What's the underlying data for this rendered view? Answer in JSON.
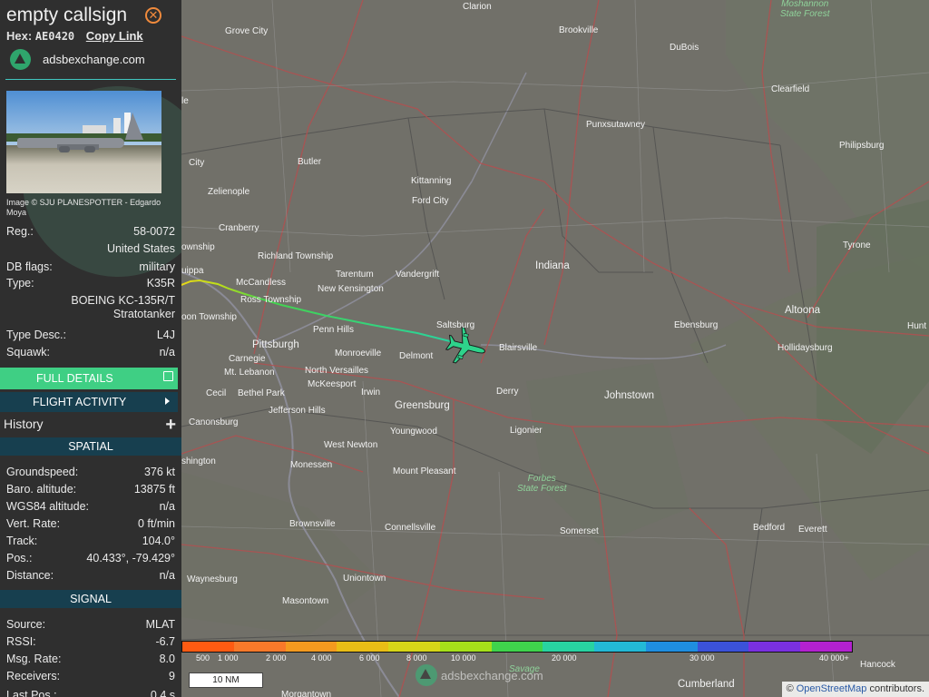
{
  "header": {
    "callsign": "empty callsign",
    "hex_label": "Hex:",
    "hex_value": "AE0420",
    "copy_link": "Copy Link",
    "site": "adsbexchange.com"
  },
  "photo": {
    "credit": "Image © SJU PLANESPOTTER - Edgardo Moya"
  },
  "aircraft": {
    "reg_label": "Reg.:",
    "reg": "58-0072",
    "country": "United States",
    "dbflags_label": "DB flags:",
    "dbflags": "military",
    "type_label": "Type:",
    "type": "K35R",
    "model": "BOEING KC-135R/T",
    "model2": "Stratotanker",
    "typedesc_label": "Type Desc.:",
    "typedesc": "L4J",
    "squawk_label": "Squawk:",
    "squawk": "n/a"
  },
  "buttons": {
    "full_details": "FULL DETAILS",
    "flight_activity": "FLIGHT ACTIVITY",
    "history": "History",
    "history_plus": "+"
  },
  "spatial": {
    "title": "SPATIAL",
    "rows": [
      {
        "label": "Groundspeed:",
        "value": "376 kt"
      },
      {
        "label": "Baro. altitude:",
        "value": "13875 ft"
      },
      {
        "label": "WGS84 altitude:",
        "value": "n/a"
      },
      {
        "label": "Vert. Rate:",
        "value": "0 ft/min"
      },
      {
        "label": "Track:",
        "value": "104.0°"
      },
      {
        "label": "Pos.:",
        "value": "40.433°, -79.429°"
      },
      {
        "label": "Distance:",
        "value": "n/a"
      }
    ]
  },
  "signal": {
    "title": "SIGNAL",
    "rows": [
      {
        "label": "Source:",
        "value": "MLAT"
      },
      {
        "label": "RSSI:",
        "value": "-6.7"
      },
      {
        "label": "Msg. Rate:",
        "value": "8.0"
      },
      {
        "label": "Receivers:",
        "value": "9"
      },
      {
        "label": "Last Pos.:",
        "value": "0.4 s"
      }
    ]
  },
  "map": {
    "towns": [
      {
        "name": "Clarion"
      },
      {
        "name": "Grove City"
      },
      {
        "name": "Brookville"
      },
      {
        "name": "DuBois"
      },
      {
        "name": "Clearfield"
      },
      {
        "name": "Punxsutawney"
      },
      {
        "name": "Philipsburg"
      },
      {
        "name": "Butler"
      },
      {
        "name": "Kittanning"
      },
      {
        "name": "Ford City"
      },
      {
        "name": "Zelienople"
      },
      {
        "name": "Cranberry"
      },
      {
        "name": "Richland Township"
      },
      {
        "name": "McCandless"
      },
      {
        "name": "Tarentum"
      },
      {
        "name": "Vandergrift"
      },
      {
        "name": "New Kensington"
      },
      {
        "name": "Indiana"
      },
      {
        "name": "Tyrone"
      },
      {
        "name": "Ross Township"
      },
      {
        "name": "Saltsburg"
      },
      {
        "name": "Ebensburg"
      },
      {
        "name": "Altoona"
      },
      {
        "name": "Penn Hills"
      },
      {
        "name": "Pittsburgh"
      },
      {
        "name": "Blairsville"
      },
      {
        "name": "Hollidaysburg"
      },
      {
        "name": "Monroeville"
      },
      {
        "name": "Delmont"
      },
      {
        "name": "Carnegie"
      },
      {
        "name": "Mt. Lebanon"
      },
      {
        "name": "North Versailles"
      },
      {
        "name": "McKeesport"
      },
      {
        "name": "Derry"
      },
      {
        "name": "Johnstown"
      },
      {
        "name": "Cecil"
      },
      {
        "name": "Bethel Park"
      },
      {
        "name": "Irwin"
      },
      {
        "name": "Greensburg"
      },
      {
        "name": "Jefferson Hills"
      },
      {
        "name": "Canonsburg"
      },
      {
        "name": "Youngwood"
      },
      {
        "name": "Ligonier"
      },
      {
        "name": "West Newton"
      },
      {
        "name": "Mount Pleasant"
      },
      {
        "name": "Monessen"
      },
      {
        "name": "Somerset"
      },
      {
        "name": "Brownsville"
      },
      {
        "name": "Connellsville"
      },
      {
        "name": "Bedford"
      },
      {
        "name": "Everett"
      },
      {
        "name": "Waynesburg"
      },
      {
        "name": "Uniontown"
      },
      {
        "name": "Masontown"
      },
      {
        "name": "Cumberland"
      },
      {
        "name": "Hancock"
      },
      {
        "name": "Morgantown"
      },
      {
        "name": "ownship"
      },
      {
        "name": "uippa"
      },
      {
        "name": "oon Township"
      },
      {
        "name": "shington"
      },
      {
        "name": "City"
      },
      {
        "name": "le"
      },
      {
        "name": "Hunt"
      }
    ],
    "forests": [
      {
        "name": "Moshannon",
        "name2": "State Forest"
      },
      {
        "name": "Forbes",
        "name2": "State Forest"
      },
      {
        "name": "Savage",
        "name2": ""
      }
    ],
    "aircraft_icon": "kc135-plane-icon",
    "track_color": "#3fcf84",
    "aircraft_color": "#2ed38b"
  },
  "altitude_scale": {
    "labels": [
      "500",
      "1 000",
      "2 000",
      "4 000",
      "6 000",
      "8 000",
      "10 000",
      "20 000",
      "30 000",
      "40 000+"
    ],
    "colors": [
      "#ff5b12",
      "#f8792a",
      "#f39a1f",
      "#e9bd16",
      "#d7d618",
      "#a6e01a",
      "#3fd34c",
      "#28d3a1",
      "#23b9d6",
      "#1f8ee0",
      "#3b52d9",
      "#7a30e0",
      "#b321d0"
    ]
  },
  "scale_bar": {
    "label": "10 NM"
  },
  "watermark": {
    "text": "adsbexchange.com"
  },
  "osm_credit": {
    "symbol": "©",
    "link": "OpenStreetMap",
    "rest": "contributors."
  }
}
